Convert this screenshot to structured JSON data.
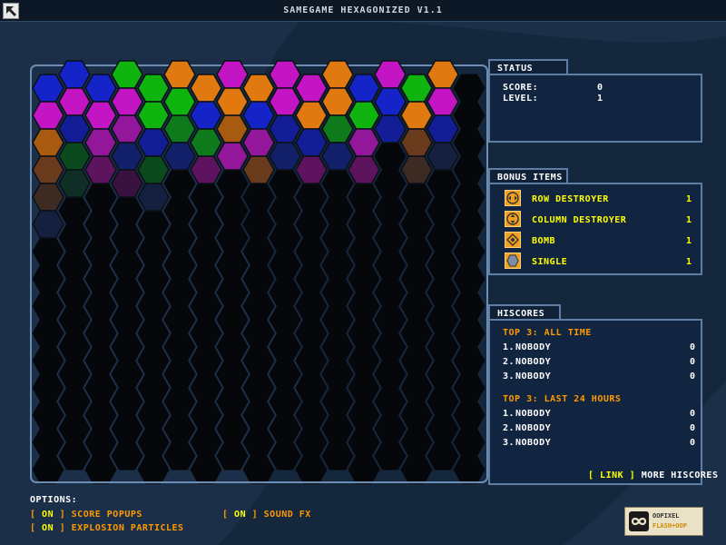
{
  "app": {
    "title": "SAMEGAME HEXAGONIZED V1.1"
  },
  "palette": {
    "O": "#e07a10",
    "G": "#0fb40f",
    "M": "#c415c4",
    "B": "#1424c8",
    "o": "#a85a10",
    "g": "#0f7a1c",
    "m": "#93179a",
    "b": "#131e96",
    "q": "#6a3a1c",
    "h": "#0a4a1c",
    "n": "#5e135e",
    "k": "#12206a",
    "r": "#3d2a22",
    "s": "#0e2e26",
    "t": "#3a1240",
    "u": "#14203e"
  },
  "board": {
    "columns": [
      "BMoqru",
      "BMbhs",
      "BMmn",
      "GMmkt",
      "GGbhu",
      "OGgk",
      "OBgn",
      "MOom",
      "OBmq",
      "MMbk",
      "MObn",
      "OOgk",
      "BGmn",
      "MBb",
      "GOqr",
      "OMbu"
    ]
  },
  "status": {
    "tab": "STATUS",
    "score_label": "SCORE:",
    "score": "0",
    "level_label": "LEVEL:",
    "level": "1"
  },
  "bonus": {
    "tab": "BONUS ITEMS",
    "items": [
      {
        "label": "ROW DESTROYER",
        "count": "1",
        "icon": "row-destroyer-icon"
      },
      {
        "label": "COLUMN DESTROYER",
        "count": "1",
        "icon": "column-destroyer-icon"
      },
      {
        "label": "BOMB",
        "count": "1",
        "icon": "bomb-icon"
      },
      {
        "label": "SINGLE",
        "count": "1",
        "icon": "single-icon"
      }
    ]
  },
  "hiscores": {
    "tab": "HISCORES",
    "all_time_title": "TOP 3: ALL TIME",
    "all_time": [
      {
        "rank": "1.",
        "name": "NOBODY",
        "score": "0"
      },
      {
        "rank": "2.",
        "name": "NOBODY",
        "score": "0"
      },
      {
        "rank": "3.",
        "name": "NOBODY",
        "score": "0"
      }
    ],
    "recent_title": "TOP 3: LAST 24 HOURS",
    "recent": [
      {
        "rank": "1.",
        "name": "NOBODY",
        "score": "0"
      },
      {
        "rank": "2.",
        "name": "NOBODY",
        "score": "0"
      },
      {
        "rank": "3.",
        "name": "NOBODY",
        "score": "0"
      }
    ],
    "link_open": "[ ",
    "link_word": "LINK",
    "link_close": " ]",
    "more_label": " MORE HISCORES"
  },
  "options": {
    "title": "OPTIONS:",
    "items": [
      {
        "bracket_open": "[ ",
        "state": "ON",
        "bracket_close": " ]",
        "label": " SCORE POPUPS"
      },
      {
        "bracket_open": "[ ",
        "state": "ON",
        "bracket_close": " ]",
        "label": " EXPLOSION PARTICLES"
      },
      {
        "bracket_open": "[ ",
        "state": "ON",
        "bracket_close": " ]",
        "label": " SOUND FX"
      }
    ]
  },
  "logo": {
    "line1": "OOPIXEL",
    "line2": "FLASH+OOP"
  }
}
